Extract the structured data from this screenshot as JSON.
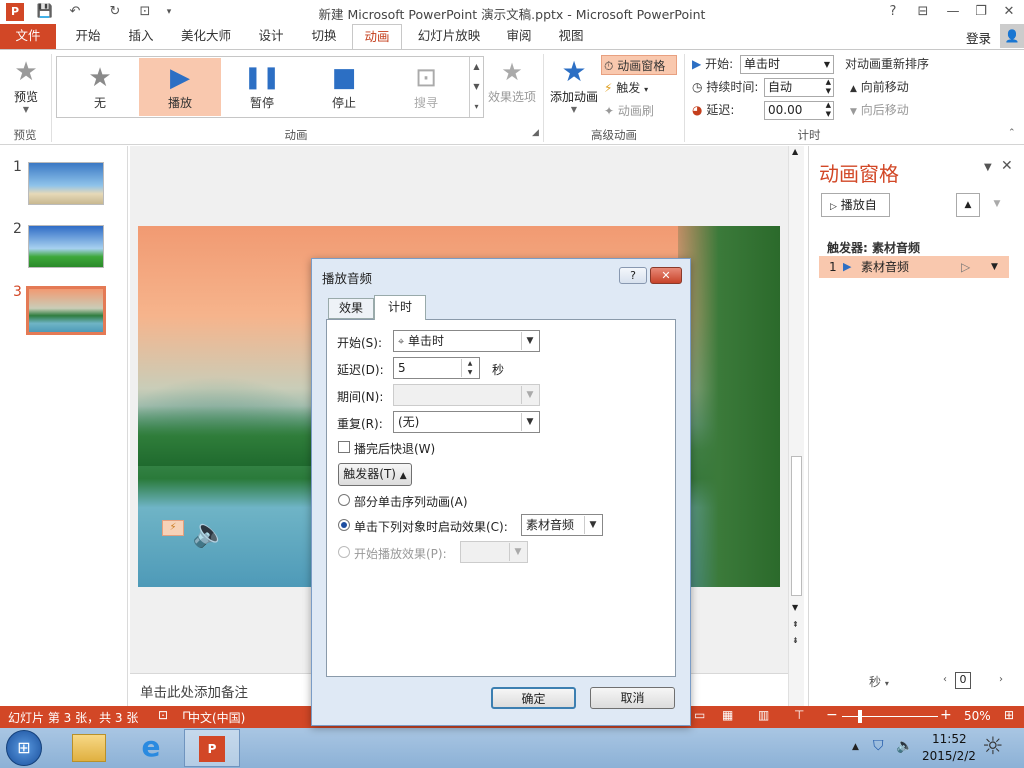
{
  "window": {
    "title": "新建 Microsoft PowerPoint 演示文稿.pptx - Microsoft PowerPoint",
    "help": "?",
    "login": "登录"
  },
  "tabs": [
    "文件",
    "开始",
    "插入",
    "美化大师",
    "设计",
    "切换",
    "动画",
    "幻灯片放映",
    "审阅",
    "视图"
  ],
  "ribbon": {
    "preview": {
      "label": "预览",
      "group": "预览"
    },
    "gallery": [
      {
        "label": "无",
        "icon": "★"
      },
      {
        "label": "播放",
        "icon": "▶"
      },
      {
        "label": "暂停",
        "icon": "❚❚"
      },
      {
        "label": "停止",
        "icon": "■"
      },
      {
        "label": "搜寻",
        "icon": "⊡"
      }
    ],
    "effect_options": "效果选项",
    "group_animation": "动画",
    "add_animation": "添加动画",
    "anim_pane_btn": "动画窗格",
    "trigger_btn": "触发",
    "anim_painter": "动画刷",
    "group_advanced": "高级动画",
    "start_label": "开始:",
    "start_value": "单击时",
    "duration_label": "持续时间:",
    "duration_value": "自动",
    "delay_label": "延迟:",
    "delay_value": "00.00",
    "group_timing": "计时",
    "reorder_title": "对动画重新排序",
    "move_earlier": "向前移动",
    "move_later": "向后移动"
  },
  "slides": [
    {
      "num": "1"
    },
    {
      "num": "2"
    },
    {
      "num": "3"
    }
  ],
  "notes_placeholder": "单击此处添加备注",
  "anim_pane": {
    "title": "动画窗格",
    "play_from": "播放自",
    "trigger_label": "触发器: 素材音频",
    "item_num": "1",
    "item_name": "素材音频",
    "seconds": "秒",
    "zoom_value": "0"
  },
  "dialog": {
    "title": "播放音频",
    "tab_effect": "效果",
    "tab_timing": "计时",
    "start_label": "开始(S):",
    "start_value": "单击时",
    "delay_label": "延迟(D):",
    "delay_value": "5",
    "delay_unit": "秒",
    "period_label": "期间(N):",
    "repeat_label": "重复(R):",
    "repeat_value": "(无)",
    "rewind_label": "播完后快退(W)",
    "trigger_button": "触发器(T)",
    "opt_sequence": "部分单击序列动画(A)",
    "opt_click_object": "单击下列对象时启动效果(C):",
    "click_object_value": "素材音频",
    "opt_start_effect": "开始播放效果(P):",
    "ok": "确定",
    "cancel": "取消"
  },
  "status": {
    "slide_info": "幻灯片 第 3 张，共 3 张",
    "language": "中文(中国)",
    "zoom": "50%"
  },
  "taskbar": {
    "time": "11:52",
    "date": "2015/2/2"
  }
}
